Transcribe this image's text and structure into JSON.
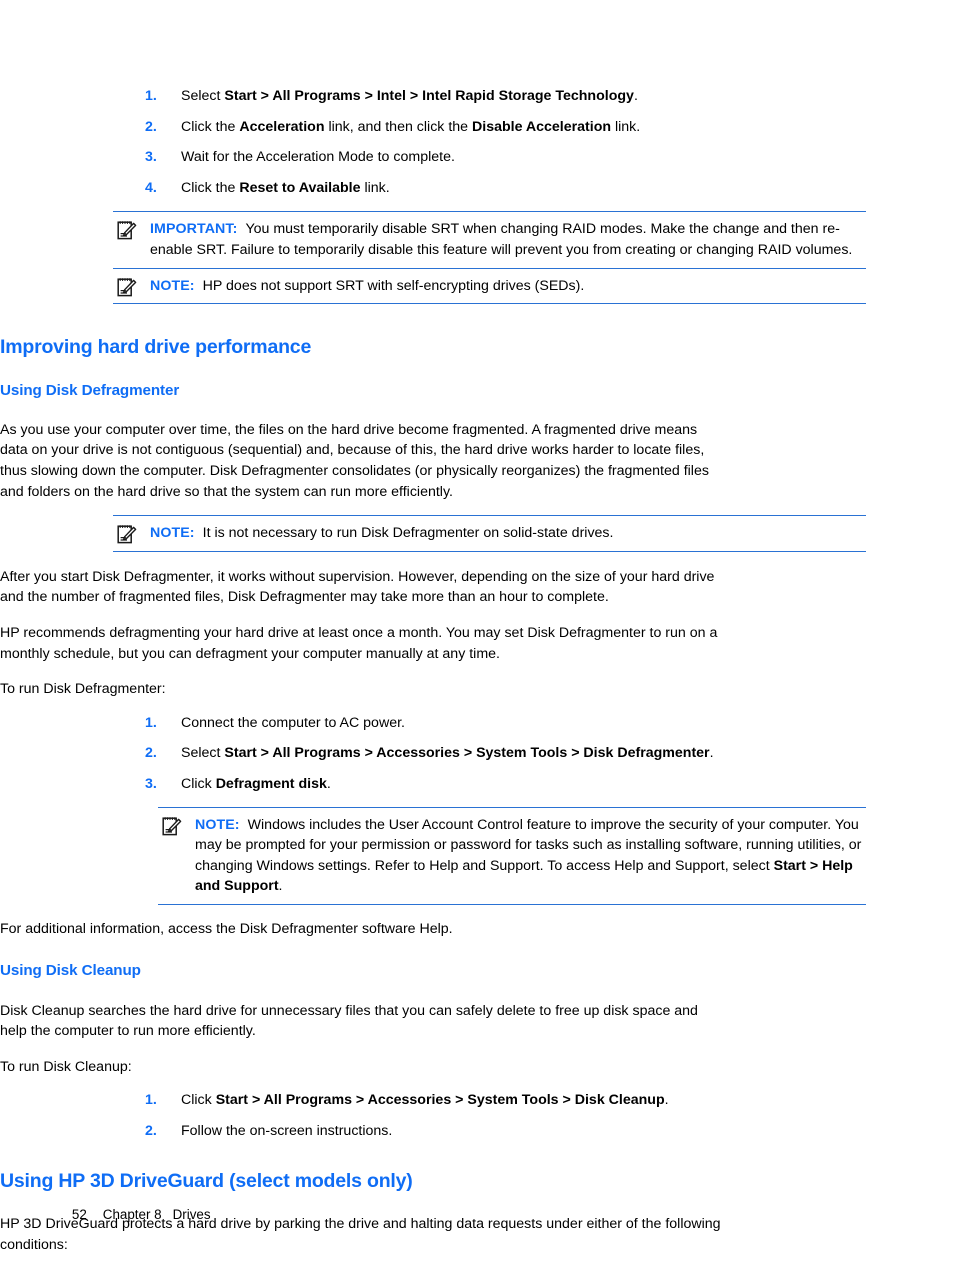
{
  "document": {
    "footer": {
      "page_number": "52",
      "chapter": "Chapter 8",
      "chapter_title": "Drives"
    },
    "accent_color": "#0f6df5",
    "rule_color": "#2a72d4"
  },
  "srt_steps": {
    "items": [
      {
        "num": "1.",
        "segments": [
          {
            "text": "Select ",
            "bold": false
          },
          {
            "text": "Start > All Programs > Intel > Intel Rapid Storage Technology",
            "bold": true
          },
          {
            "text": ".",
            "bold": false
          }
        ]
      },
      {
        "num": "2.",
        "segments": [
          {
            "text": "Click the ",
            "bold": false
          },
          {
            "text": "Acceleration",
            "bold": true
          },
          {
            "text": " link, and then click the ",
            "bold": false
          },
          {
            "text": "Disable Acceleration",
            "bold": true
          },
          {
            "text": " link.",
            "bold": false
          }
        ]
      },
      {
        "num": "3.",
        "segments": [
          {
            "text": "Wait for the Acceleration Mode to complete.",
            "bold": false
          }
        ]
      },
      {
        "num": "4.",
        "segments": [
          {
            "text": "Click the ",
            "bold": false
          },
          {
            "text": "Reset to Available",
            "bold": true
          },
          {
            "text": " link.",
            "bold": false
          }
        ]
      }
    ]
  },
  "important_srt": {
    "keyword": "IMPORTANT:",
    "icon": "important-notepad-pencil-icon",
    "text": "You must temporarily disable SRT when changing RAID modes. Make the change and then re-enable SRT. Failure to temporarily disable this feature will prevent you from creating or changing RAID volumes."
  },
  "note_srt_sed": {
    "keyword": "NOTE:",
    "icon": "note-notepad-pencil-icon",
    "text": "HP does not support SRT with self-encrypting drives (SEDs)."
  },
  "section_improving": {
    "heading": "Improving hard drive performance"
  },
  "defrag": {
    "heading": "Using Disk Defragmenter",
    "intro": "As you use your computer over time, the files on the hard drive become fragmented. A fragmented drive means data on your drive is not contiguous (sequential) and, because of this, the hard drive works harder to locate files, thus slowing down the computer. Disk Defragmenter consolidates (or physically reorganizes) the fragmented files and folders on the hard drive so that the system can run more efficiently.",
    "note_ssd": {
      "keyword": "NOTE:",
      "icon": "note-notepad-pencil-icon",
      "text": "It is not necessary to run Disk Defragmenter on solid-state drives."
    },
    "para_supervision": "After you start Disk Defragmenter, it works without supervision. However, depending on the size of your hard drive and the number of fragmented files, Disk Defragmenter may take more than an hour to complete.",
    "para_monthly": "HP recommends defragmenting your hard drive at least once a month. You may set Disk Defragmenter to run on a monthly schedule, but you can defragment your computer manually at any time.",
    "lead_in": "To run Disk Defragmenter:",
    "steps": [
      {
        "num": "1.",
        "segments": [
          {
            "text": "Connect the computer to AC power.",
            "bold": false
          }
        ]
      },
      {
        "num": "2.",
        "segments": [
          {
            "text": "Select ",
            "bold": false
          },
          {
            "text": "Start > All Programs > Accessories > System Tools > Disk Defragmenter",
            "bold": true
          },
          {
            "text": ".",
            "bold": false
          }
        ]
      },
      {
        "num": "3.",
        "segments": [
          {
            "text": "Click ",
            "bold": false
          },
          {
            "text": "Defragment disk",
            "bold": true
          },
          {
            "text": ".",
            "bold": false
          }
        ]
      }
    ],
    "note_uac": {
      "keyword": "NOTE:",
      "icon": "note-notepad-pencil-icon",
      "segments": [
        {
          "text": "Windows includes the User Account Control feature to improve the security of your computer. You may be prompted for your permission or password for tasks such as installing software, running utilities, or changing Windows settings. Refer to Help and Support. To access Help and Support, select ",
          "bold": false
        },
        {
          "text": "Start > Help and Support",
          "bold": true
        },
        {
          "text": ".",
          "bold": false
        }
      ]
    },
    "para_help": "For additional information, access the Disk Defragmenter software Help."
  },
  "cleanup": {
    "heading": "Using Disk Cleanup",
    "intro": "Disk Cleanup searches the hard drive for unnecessary files that you can safely delete to free up disk space and help the computer to run more efficiently.",
    "lead_in": "To run Disk Cleanup:",
    "steps": [
      {
        "num": "1.",
        "segments": [
          {
            "text": "Click ",
            "bold": false
          },
          {
            "text": "Start > All Programs > Accessories > System Tools > Disk Cleanup",
            "bold": true
          },
          {
            "text": ".",
            "bold": false
          }
        ]
      },
      {
        "num": "2.",
        "segments": [
          {
            "text": "Follow the on-screen instructions.",
            "bold": false
          }
        ]
      }
    ]
  },
  "driveguard": {
    "heading": "Using HP 3D DriveGuard (select models only)",
    "intro": "HP 3D DriveGuard protects a hard drive by parking the drive and halting data requests under either of the following conditions:"
  }
}
